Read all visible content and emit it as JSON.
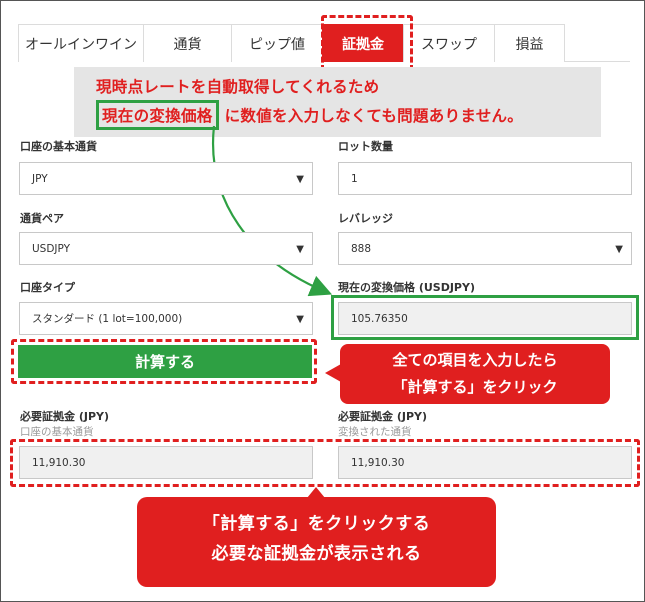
{
  "tabs": [
    {
      "label": "オールインワイン",
      "active": false
    },
    {
      "label": "通貨",
      "active": false
    },
    {
      "label": "ピップ値",
      "active": false
    },
    {
      "label": "証拠金",
      "active": true
    },
    {
      "label": "スワップ",
      "active": false
    },
    {
      "label": "損益",
      "active": false
    }
  ],
  "annotation_top": {
    "line1": "現時点レートを自動取得してくれるため",
    "line2_highlight": "現在の変換価格",
    "line2_rest": "に数値を入力しなくても問題ありません。"
  },
  "form": {
    "base_currency_label": "口座の基本通貨",
    "base_currency_value": "JPY",
    "lot_label": "ロット数量",
    "lot_value": "1",
    "pair_label": "通貨ペア",
    "pair_value": "USDJPY",
    "leverage_label": "レバレッジ",
    "leverage_value": "888",
    "account_type_label": "口座タイプ",
    "account_type_value": "スタンダード (1 lot=100,000)",
    "rate_label": "現在の変換価格 (USDJPY)",
    "rate_value": "105.76350",
    "calc_button": "計算する"
  },
  "results": {
    "margin_label_left": "必要証拠金 (JPY)",
    "margin_sub_left": "口座の基本通貨",
    "margin_value_left": "11,910.30",
    "margin_label_right": "必要証拠金 (JPY)",
    "margin_sub_right": "変換された通貨",
    "margin_value_right": "11,910.30"
  },
  "callouts": {
    "bubble1_line1": "全ての項目を入力したら",
    "bubble1_line2": "「計算する」をクリック",
    "bubble2_line1": "「計算する」をクリックする",
    "bubble2_line2": "必要な証拠金が表示される"
  },
  "colors": {
    "accent_red": "#e01f1f",
    "accent_green": "#2ea043"
  }
}
